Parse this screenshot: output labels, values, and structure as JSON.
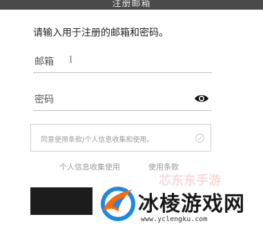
{
  "header": {
    "title": "注册邮箱"
  },
  "form": {
    "instruction": "请输入用于注册的邮箱和密码。",
    "email_placeholder": "邮箱",
    "password_placeholder": "密码",
    "consent_text": "同意使用条款/个人信息收集和使用。",
    "privacy_link": "个人信息收集使用",
    "terms_link": "使用条款"
  },
  "watermark": {
    "brand": "冰棱游戏网",
    "url": "www.yclengku.com",
    "faint_text": "芯东东手游"
  },
  "colors": {
    "header_bg": "#4a4a4a",
    "button_bg": "#1c1c1c",
    "logo_blue": "#1e88e5",
    "logo_orange": "#ff6a00"
  },
  "icons": {
    "cursor": "I",
    "eye": "eye-icon",
    "check": "check-circle-icon"
  }
}
